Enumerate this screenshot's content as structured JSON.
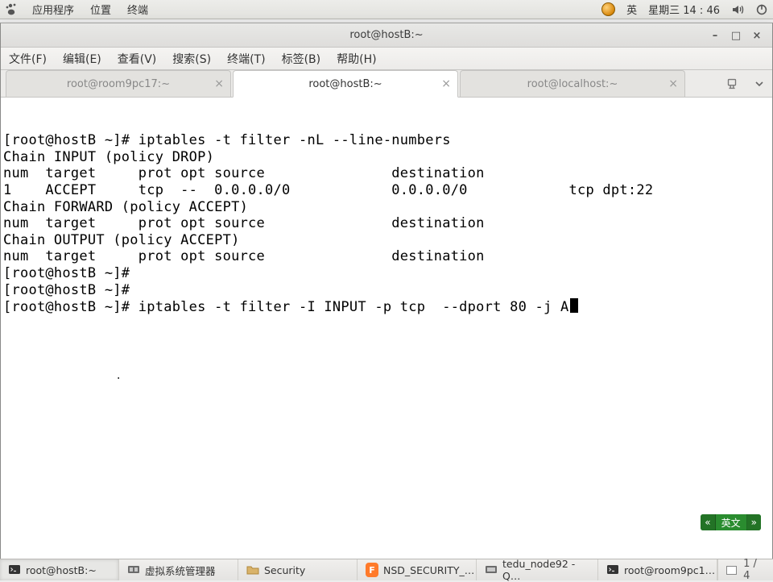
{
  "topbar": {
    "apps": "应用程序",
    "places": "位置",
    "terminal": "终端",
    "lang": "英",
    "date": "星期三 14 : 46"
  },
  "window": {
    "title": "root@hostB:~",
    "menu": {
      "file": "文件(F)",
      "edit": "编辑(E)",
      "view": "查看(V)",
      "search": "搜索(S)",
      "terminal": "终端(T)",
      "tabs_menu": "标签(B)",
      "help": "帮助(H)"
    },
    "tabs": [
      {
        "label": "root@room9pc17:~",
        "active": false
      },
      {
        "label": "root@hostB:~",
        "active": true
      },
      {
        "label": "root@localhost:~",
        "active": false
      }
    ]
  },
  "terminal_lines": [
    "[root@hostB ~]# iptables -t filter -nL --line-numbers",
    "Chain INPUT (policy DROP)",
    "num  target     prot opt source               destination",
    "1    ACCEPT     tcp  --  0.0.0.0/0            0.0.0.0/0            tcp dpt:22",
    "",
    "Chain FORWARD (policy ACCEPT)",
    "num  target     prot opt source               destination",
    "",
    "Chain OUTPUT (policy ACCEPT)",
    "num  target     prot opt source               destination",
    "[root@hostB ~]#",
    "[root@hostB ~]#",
    "[root@hostB ~]# iptables -t filter -I INPUT -p tcp  --dport 80 -j A"
  ],
  "ime": {
    "arrow": "«",
    "label": "英文",
    "chev": "»"
  },
  "taskbar": {
    "items": [
      {
        "label": "root@hostB:~",
        "icon": "terminal"
      },
      {
        "label": "虚拟系统管理器",
        "icon": "vm"
      },
      {
        "label": "Security",
        "icon": "folder"
      },
      {
        "label": "NSD_SECURITY_…",
        "icon": "firefox"
      },
      {
        "label": "tedu_node92 - Q…",
        "icon": "vm"
      },
      {
        "label": "root@room9pc1…",
        "icon": "terminal"
      }
    ],
    "pager": "1 / 4"
  }
}
